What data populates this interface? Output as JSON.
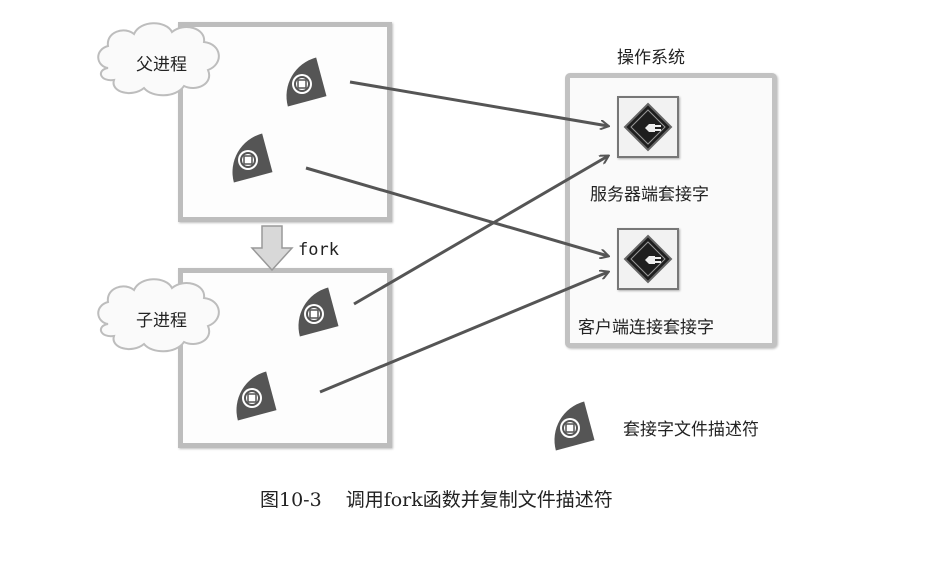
{
  "parent": {
    "label": "父进程"
  },
  "child": {
    "label": "子进程"
  },
  "fork": {
    "label": "fork"
  },
  "os": {
    "title": "操作系统",
    "server_socket_label": "服务器端套接字",
    "client_socket_label": "客户端连接套接字"
  },
  "legend": {
    "label": "套接字文件描述符"
  },
  "caption": {
    "figure": "图10-3",
    "text": "调用fork函数并复制文件描述符"
  },
  "colors": {
    "fd_icon": "#555555",
    "arrow": "#555555",
    "box_border": "#bdbdbd"
  }
}
